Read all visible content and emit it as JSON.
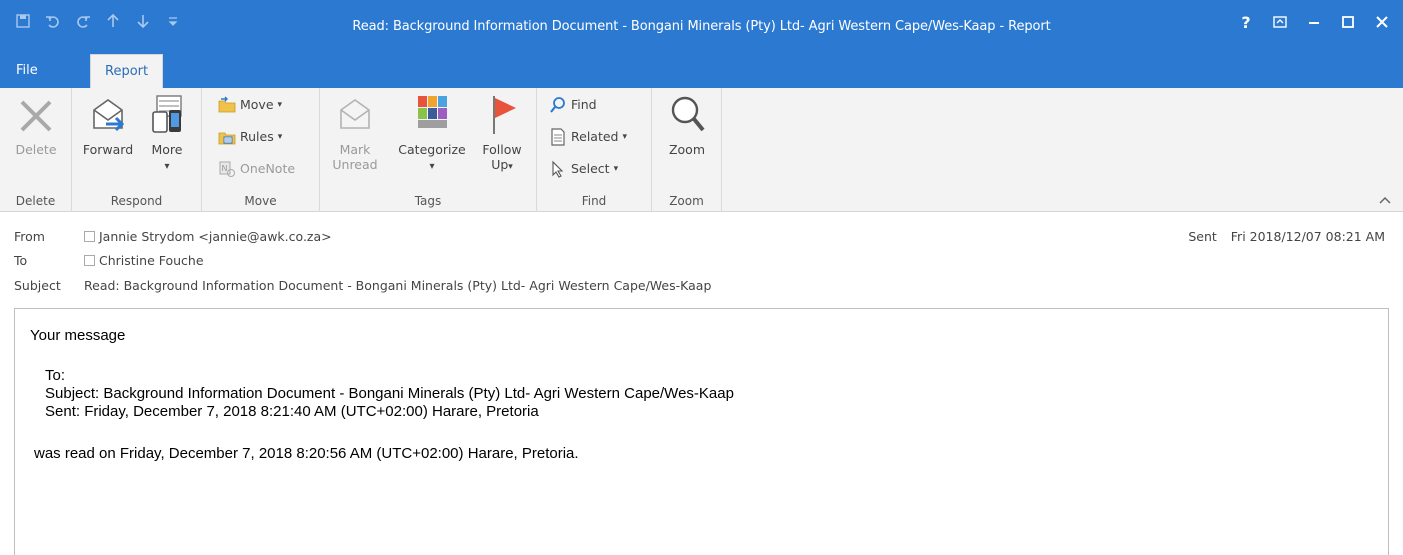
{
  "window": {
    "title": "Read: Background Information Document - Bongani Minerals (Pty) Ltd- Agri Western Cape/Wes-Kaap - Report",
    "qat": [
      "save-icon",
      "undo-icon",
      "redo-icon",
      "up-arrow-icon",
      "down-arrow-icon",
      "customize-qat-icon"
    ],
    "controls": {
      "help": "?",
      "restore_ribbon": "⧉",
      "minimize": "—",
      "maximize": "☐",
      "close": "✕"
    }
  },
  "tabs": [
    {
      "label": "File"
    },
    {
      "label": "Report",
      "active": true
    }
  ],
  "ribbon": {
    "groups": {
      "delete": "Delete",
      "respond": "Respond",
      "move": "Move",
      "tags": "Tags",
      "find": "Find",
      "zoom": "Zoom"
    },
    "buttons": {
      "delete": "Delete",
      "forward": "Forward",
      "more": "More",
      "more_arrow": "▾",
      "move": "Move",
      "rules": "Rules",
      "onenote": "OneNote",
      "mark_unread_1": "Mark",
      "mark_unread_2": "Unread",
      "categorize": "Categorize",
      "categorize_arrow": "▾",
      "follow_up_1": "Follow",
      "follow_up_2": "Up",
      "find": "Find",
      "related": "Related",
      "select": "Select",
      "zoom": "Zoom",
      "dropdown_arrow": "▾"
    }
  },
  "header": {
    "from_label": "From",
    "from_value": "Jannie Strydom <jannie@awk.co.za>",
    "to_label": "To",
    "to_value": "Christine Fouche",
    "subject_label": "Subject",
    "subject_value": "Read: Background Information Document - Bongani Minerals (Pty) Ltd- Agri Western Cape/Wes-Kaap",
    "sent_label": "Sent",
    "sent_value": "Fri 2018/12/07 08:21 AM"
  },
  "body": {
    "line1": "Your message",
    "to_line": "To:",
    "subject_line": "Subject: Background Information Document - Bongani Minerals (Pty) Ltd- Agri Western Cape/Wes-Kaap",
    "sent_line": "Sent: Friday, December 7, 2018 8:21:40 AM (UTC+02:00) Harare, Pretoria",
    "read_line": "was read on Friday, December 7, 2018 8:20:56 AM (UTC+02:00) Harare, Pretoria."
  },
  "colors": {
    "accent": "#2b79d0",
    "ribbon_bg": "#f3f3f3",
    "flag": "#e8533b"
  }
}
